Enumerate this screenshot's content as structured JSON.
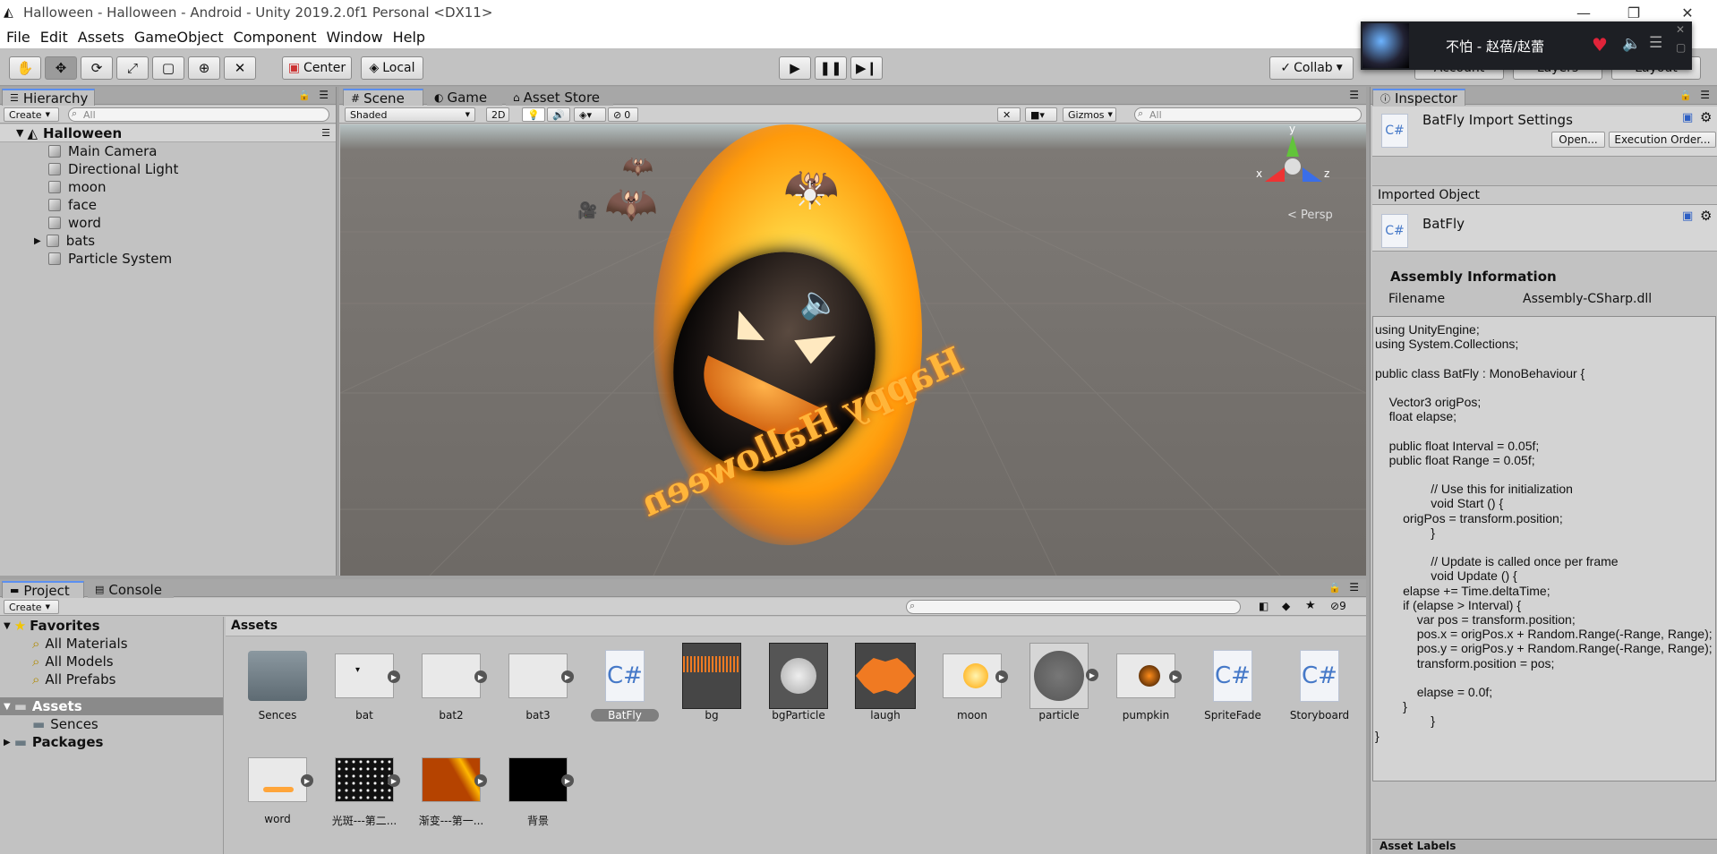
{
  "window": {
    "title": "Halloween - Halloween - Android - Unity 2019.2.0f1 Personal <DX11>"
  },
  "menu": [
    "File",
    "Edit",
    "Assets",
    "GameObject",
    "Component",
    "Window",
    "Help"
  ],
  "toolbar": {
    "pivot": "Center",
    "space": "Local",
    "collab": "Collab",
    "account": "Account",
    "layers": "Layers",
    "layout": "Layout"
  },
  "music": {
    "song": "不怕 - 赵蓓/赵蕾"
  },
  "hierarchy": {
    "tab": "Hierarchy",
    "create": "Create",
    "search": "All",
    "scene": "Halloween",
    "items": [
      "Main Camera",
      "Directional Light",
      "moon",
      "face",
      "word",
      "bats",
      "Particle System"
    ]
  },
  "scene": {
    "tabs": [
      "Scene",
      "Game",
      "Asset Store"
    ],
    "shading": "Shaded",
    "mode2d": "2D",
    "fx_count": "0",
    "gizmos": "Gizmos",
    "search": "All",
    "persp": "Persp",
    "axes": {
      "x": "x",
      "y": "y",
      "z": "z"
    }
  },
  "inspector": {
    "tab": "Inspector",
    "title": "BatFly Import Settings",
    "open": "Open...",
    "exec": "Execution Order...",
    "imported": "Imported Object",
    "obj": "BatFly",
    "assembly": "Assembly Information",
    "filename_label": "Filename",
    "filename_value": "Assembly-CSharp.dll",
    "code": "using UnityEngine;\nusing System.Collections;\n\npublic class BatFly : MonoBehaviour {\n\n    Vector3 origPos;\n    float elapse;\n\n    public float Interval = 0.05f;\n    public float Range = 0.05f;\n\n                // Use this for initialization\n                void Start () {\n        origPos = transform.position;\n                }\n\n                // Update is called once per frame\n                void Update () {\n        elapse += Time.deltaTime;\n        if (elapse > Interval) {\n            var pos = transform.position;\n            pos.x = origPos.x + Random.Range(-Range, Range);\n            pos.y = origPos.y + Random.Range(-Range, Range);\n            transform.position = pos;\n\n            elapse = 0.0f;\n        }\n                }\n}",
    "footer": "Asset Labels"
  },
  "project": {
    "tabs": [
      "Project",
      "Console"
    ],
    "create": "Create",
    "hidden_count": "9",
    "breadcrumb": "Assets",
    "tree": {
      "favorites": "Favorites",
      "fav_items": [
        "All Materials",
        "All Models",
        "All Prefabs"
      ],
      "assets": "Assets",
      "sences": "Sences",
      "packages": "Packages"
    },
    "assets": [
      "Sences",
      "bat",
      "bat2",
      "bat3",
      "BatFly",
      "bg",
      "bgParticle",
      "laugh",
      "moon",
      "particle",
      "pumpkin",
      "SpriteFade",
      "Storyboard",
      "word",
      "光斑---第二...",
      "渐变---第一...",
      "背景"
    ]
  },
  "scene_text": "Happy Halloween",
  "colors": {
    "accent": "#5b8ff0",
    "selected": "#8a8a8a"
  }
}
